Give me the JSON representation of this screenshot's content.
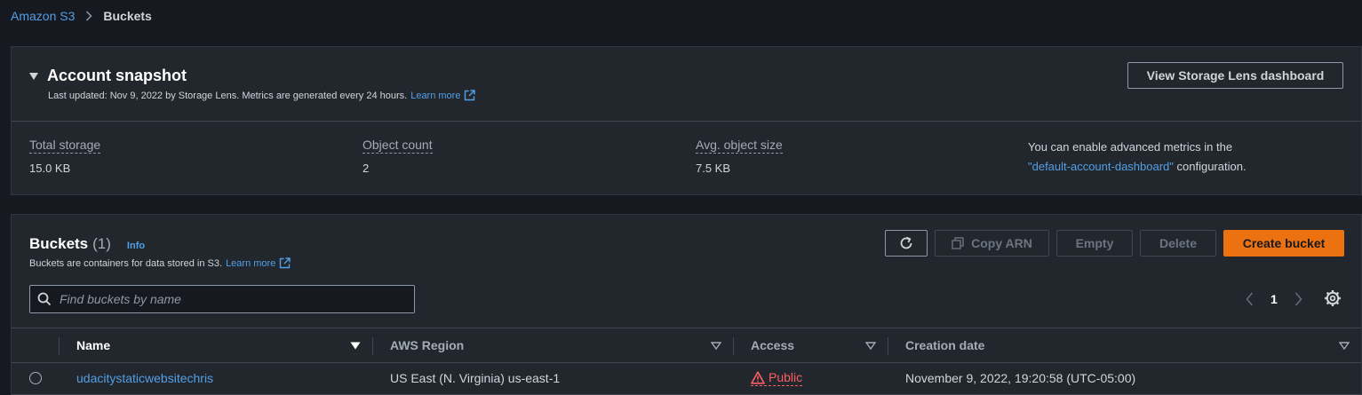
{
  "breadcrumb": {
    "root": "Amazon S3",
    "current": "Buckets"
  },
  "snapshot": {
    "title": "Account snapshot",
    "subtitle": "Last updated: Nov 9, 2022 by Storage Lens. Metrics are generated every 24 hours.",
    "learn_more": "Learn more",
    "view_lens_button": "View Storage Lens dashboard",
    "metrics": [
      {
        "label": "Total storage",
        "value": "15.0 KB"
      },
      {
        "label": "Object count",
        "value": "2"
      },
      {
        "label": "Avg. object size",
        "value": "7.5 KB"
      }
    ],
    "advanced_prefix": "You can enable advanced metrics in the",
    "advanced_link": "\"default-account-dashboard\"",
    "advanced_suffix": "configuration."
  },
  "buckets": {
    "title": "Buckets",
    "count": "(1)",
    "info": "Info",
    "subtitle": "Buckets are containers for data stored in S3.",
    "learn_more": "Learn more",
    "buttons": {
      "copy_arn": "Copy ARN",
      "empty": "Empty",
      "delete": "Delete",
      "create": "Create bucket"
    },
    "search_placeholder": "Find buckets by name",
    "page": "1",
    "columns": {
      "name": "Name",
      "region": "AWS Region",
      "access": "Access",
      "created": "Creation date"
    },
    "rows": [
      {
        "name": "udacitystaticwebsitechris",
        "region": "US East (N. Virginia) us-east-1",
        "access": "Public",
        "created": "November 9, 2022, 19:20:58 (UTC-05:00)"
      }
    ]
  },
  "colors": {
    "accent_link": "#539fe5",
    "primary_button": "#ec7211",
    "public_warning": "#ff5d64",
    "panel_bg": "#22272e",
    "page_bg": "#16191f"
  },
  "icons": {
    "breadcrumb_separator": "chevron-right-icon",
    "snapshot_toggle": "caret-down-icon",
    "external_link": "external-link-icon",
    "refresh": "refresh-icon",
    "copy": "copy-icon",
    "search": "search-icon",
    "pager_prev": "chevron-left-icon",
    "pager_next": "chevron-right-icon",
    "settings": "gear-icon",
    "sort": "caret-down-icon",
    "warning": "warning-icon"
  }
}
